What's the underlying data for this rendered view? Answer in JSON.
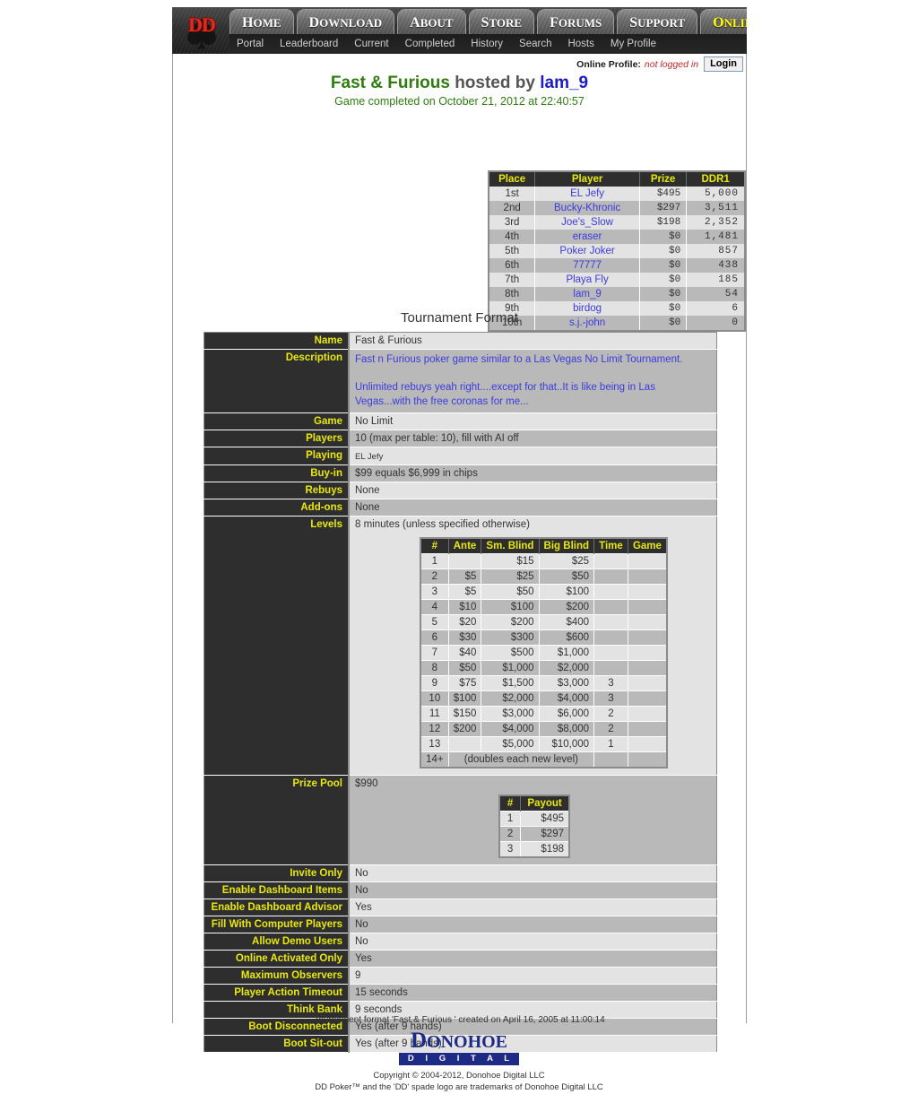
{
  "nav": {
    "logo_alt": "DD spade logo",
    "main_tabs": [
      {
        "label": "Home",
        "selected": false
      },
      {
        "label": "Download",
        "selected": false
      },
      {
        "label": "About",
        "selected": false
      },
      {
        "label": "Store",
        "selected": false
      },
      {
        "label": "Forums",
        "selected": false
      },
      {
        "label": "Support",
        "selected": false
      },
      {
        "label": "Online",
        "selected": true
      }
    ],
    "sub_tabs": [
      {
        "label": "Portal"
      },
      {
        "label": "Leaderboard"
      },
      {
        "label": "Current"
      },
      {
        "label": "Completed"
      },
      {
        "label": "History"
      },
      {
        "label": "Search"
      },
      {
        "label": "Hosts"
      },
      {
        "label": "My Profile"
      }
    ]
  },
  "profile_bar": {
    "label": "Online Profile:",
    "status": "not logged in",
    "login_label": "Login"
  },
  "header": {
    "game_name": "Fast & Furious",
    "hosted_by": "hosted by",
    "host": "lam_9",
    "subtitle": "Game completed on October 21, 2012 at 22:40:57"
  },
  "results": {
    "columns": [
      "Place",
      "Player",
      "Prize",
      "DDR1"
    ],
    "rows": [
      {
        "place": "1st",
        "player": "EL Jefy",
        "prize": "$495",
        "ddr1": "5,000"
      },
      {
        "place": "2nd",
        "player": "Bucky-Khronic",
        "prize": "$297",
        "ddr1": "3,511"
      },
      {
        "place": "3rd",
        "player": "Joe's_Slow",
        "prize": "$198",
        "ddr1": "2,352"
      },
      {
        "place": "4th",
        "player": "eraser",
        "prize": "$0",
        "ddr1": "1,481"
      },
      {
        "place": "5th",
        "player": "Poker Joker",
        "prize": "$0",
        "ddr1": "857"
      },
      {
        "place": "6th",
        "player": "77777",
        "prize": "$0",
        "ddr1": "438"
      },
      {
        "place": "7th",
        "player": "Playa Fly",
        "prize": "$0",
        "ddr1": "185"
      },
      {
        "place": "8th",
        "player": "lam_9",
        "prize": "$0",
        "ddr1": "54"
      },
      {
        "place": "9th",
        "player": "birdog",
        "prize": "$0",
        "ddr1": "6"
      },
      {
        "place": "10th",
        "player": "s.j.-john",
        "prize": "$0",
        "ddr1": "0"
      }
    ]
  },
  "format": {
    "heading": "Tournament Format",
    "labels": {
      "name": "Name",
      "description": "Description",
      "game": "Game",
      "players": "Players",
      "playing": "Playing",
      "buyin": "Buy-in",
      "rebuys": "Rebuys",
      "addons": "Add-ons",
      "levels": "Levels",
      "prize_pool": "Prize Pool",
      "invite_only": "Invite Only",
      "enable_dashboard_items": "Enable Dashboard Items",
      "enable_dashboard_advisor": "Enable Dashboard Advisor",
      "fill_with_computer_players": "Fill With Computer Players",
      "allow_demo_users": "Allow Demo Users",
      "online_activated_only": "Online Activated Only",
      "maximum_observers": "Maximum Observers",
      "player_action_timeout": "Player Action Timeout",
      "think_bank": "Think Bank",
      "boot_disconnected": "Boot Disconnected",
      "boot_sitout": "Boot Sit-out"
    },
    "values": {
      "name": "Fast & Furious",
      "description_p1": "Fast n Furious poker game similar to a Las Vegas No Limit Tournament.",
      "description_p2": "Unlimited rebuys yeah right....except for that..It is like being in Las Vegas...with the free coronas for me...",
      "game": "No Limit",
      "players": "10 (max per table: 10), fill with AI off",
      "playing": "EL Jefy",
      "buyin": "$99 equals $6,999 in chips",
      "rebuys": "None",
      "addons": "None",
      "levels": "8 minutes (unless specified otherwise)",
      "prize_pool": "$990",
      "invite_only": "No",
      "enable_dashboard_items": "No",
      "enable_dashboard_advisor": "Yes",
      "fill_with_computer_players": "No",
      "allow_demo_users": "No",
      "online_activated_only": "Yes",
      "maximum_observers": "9",
      "player_action_timeout": "15 seconds",
      "think_bank": "9 seconds",
      "boot_disconnected": "Yes (after 9 hands)",
      "boot_sitout": "Yes (after 9 hands)"
    },
    "levels_table": {
      "columns": [
        "#",
        "Ante",
        "Sm. Blind",
        "Big Blind",
        "Time",
        "Game"
      ],
      "rows": [
        {
          "n": "1",
          "ante": "",
          "sb": "$15",
          "bb": "$25",
          "time": "",
          "game": ""
        },
        {
          "n": "2",
          "ante": "$5",
          "sb": "$25",
          "bb": "$50",
          "time": "",
          "game": ""
        },
        {
          "n": "3",
          "ante": "$5",
          "sb": "$50",
          "bb": "$100",
          "time": "",
          "game": ""
        },
        {
          "n": "4",
          "ante": "$10",
          "sb": "$100",
          "bb": "$200",
          "time": "",
          "game": ""
        },
        {
          "n": "5",
          "ante": "$20",
          "sb": "$200",
          "bb": "$400",
          "time": "",
          "game": ""
        },
        {
          "n": "6",
          "ante": "$30",
          "sb": "$300",
          "bb": "$600",
          "time": "",
          "game": ""
        },
        {
          "n": "7",
          "ante": "$40",
          "sb": "$500",
          "bb": "$1,000",
          "time": "",
          "game": ""
        },
        {
          "n": "8",
          "ante": "$50",
          "sb": "$1,000",
          "bb": "$2,000",
          "time": "",
          "game": ""
        },
        {
          "n": "9",
          "ante": "$75",
          "sb": "$1,500",
          "bb": "$3,000",
          "time": "3",
          "game": ""
        },
        {
          "n": "10",
          "ante": "$100",
          "sb": "$2,000",
          "bb": "$4,000",
          "time": "3",
          "game": ""
        },
        {
          "n": "11",
          "ante": "$150",
          "sb": "$3,000",
          "bb": "$6,000",
          "time": "2",
          "game": ""
        },
        {
          "n": "12",
          "ante": "$200",
          "sb": "$4,000",
          "bb": "$8,000",
          "time": "2",
          "game": ""
        },
        {
          "n": "13",
          "ante": "",
          "sb": "$5,000",
          "bb": "$10,000",
          "time": "1",
          "game": ""
        }
      ],
      "final_row": {
        "n": "14+",
        "text": "(doubles each new level)"
      }
    },
    "payout_table": {
      "columns": [
        "#",
        "Payout"
      ],
      "rows": [
        {
          "n": "1",
          "payout": "$495"
        },
        {
          "n": "2",
          "payout": "$297"
        },
        {
          "n": "3",
          "payout": "$198"
        }
      ]
    },
    "note": "Tournament format 'Fast & Furious ' created on April 16, 2005 at 11:00:14"
  },
  "footer": {
    "logo_word_cap": "D",
    "logo_word_rest": "ONOHOE",
    "logo_bar": "D I G I T A L",
    "copyright_line1": "Copyright © 2004-2012, Donohoe Digital LLC",
    "copyright_line2": "DD Poker™ and the 'DD' spade logo are trademarks of Donohoe Digital LLC"
  },
  "colors": {
    "header_yellow": "#e8e80c",
    "dark_row": "#2e2e2e",
    "link_blue": "#3b3bdd",
    "title_green": "#2e7d0e",
    "logo_blue": "#1d2a86",
    "logo_red": "#e02b20"
  }
}
